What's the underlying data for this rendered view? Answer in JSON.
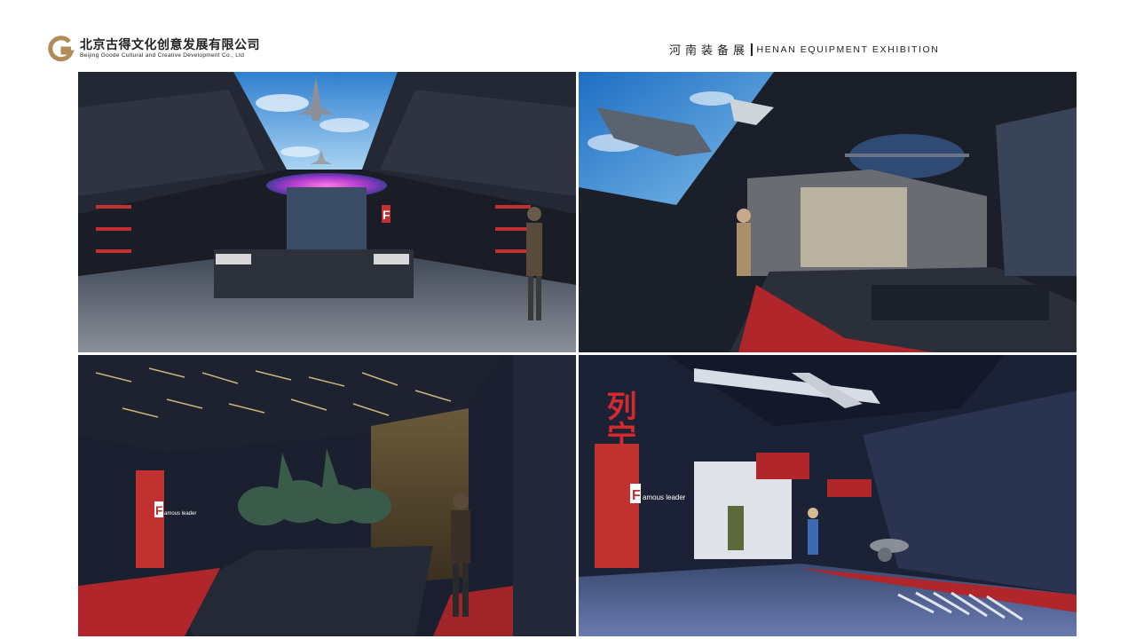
{
  "company": {
    "logo_icon": "g-logo-icon",
    "name_cn": "北京古得文化创意发展有限公司",
    "name_en": "Beijing Goode Cultural and Creative Development Co., Ltd",
    "logo_color": "#b08d57"
  },
  "exhibition": {
    "title_cn": "河南装备展",
    "title_en": "HENAN EQUIPMENT EXHIBITION"
  },
  "renderings": [
    {
      "name": "aircraft-ceiling-hall",
      "sign_text": "F"
    },
    {
      "name": "helicopter-diorama-hall"
    },
    {
      "name": "bronze-horses-hall",
      "sign_text": "F",
      "panel_text": "amous leader"
    },
    {
      "name": "famous-leader-hall",
      "sign_text": "F",
      "panel_text": "amous leader",
      "big_text": "列宁号"
    }
  ]
}
